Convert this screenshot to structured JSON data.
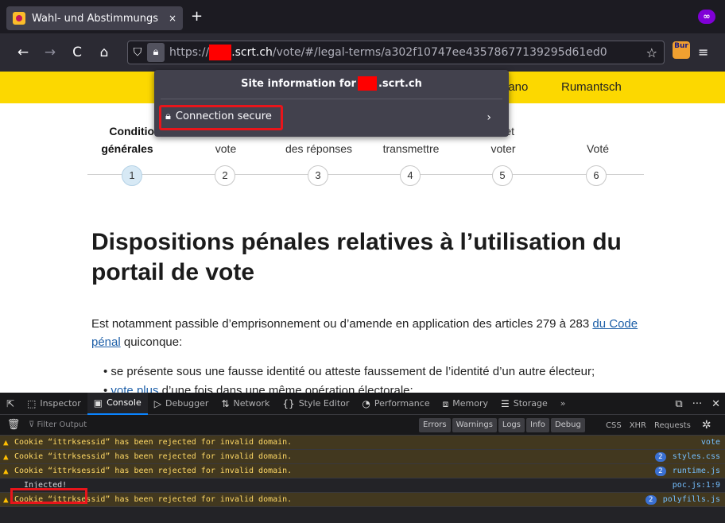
{
  "tab": {
    "title": "Wahl- und Abstimmungs",
    "close": "×"
  },
  "toolbar": {
    "new_tab": "+",
    "back": "←",
    "forward": "→",
    "reload": "C",
    "home": "⌂",
    "bookmark": "☆",
    "menu": "≡",
    "extension_label": "Bur"
  },
  "url": {
    "scheme": "https://",
    "host": ".scrt.ch",
    "path": "/vote/#/legal-terms/a302f10747ee43578677139295d61ed0"
  },
  "site_info": {
    "title_prefix": "Site information for",
    "title_host": ".scrt.ch",
    "connection_label": "Connection secure",
    "chevron": "›"
  },
  "languages": [
    "iano",
    "Rumantsch"
  ],
  "steps": [
    {
      "line1": "Condition",
      "line2": "générales",
      "number": "1",
      "active": true
    },
    {
      "line1": "",
      "line2": "vote",
      "number": "2",
      "active": false
    },
    {
      "line1": "",
      "line2": "des réponses",
      "number": "3",
      "active": false
    },
    {
      "line1": "",
      "line2": "transmettre",
      "number": "4",
      "active": false
    },
    {
      "line1": "er et",
      "line2": "voter",
      "number": "5",
      "active": false
    },
    {
      "line1": "",
      "line2": "Voté",
      "number": "6",
      "active": false
    }
  ],
  "content": {
    "heading": "Dispositions pénales relatives à l’utilisation du portail de vote",
    "para_before": "Est notamment passible d’emprisonnement ou d’amende en application des articles 279 à 283 ",
    "para_link": "du Code pénal",
    "para_after": " quiconque:",
    "bullet1": "se présente sous une fausse identité ou atteste faussement de l’identité d’un autre électeur;",
    "bullet2_link": "vote plus",
    "bullet2_rest": " d’une fois dans une même opération électorale;"
  },
  "devtools": {
    "tabs": [
      {
        "name": "inspector",
        "icon": "⬚",
        "label": "Inspector"
      },
      {
        "name": "console",
        "icon": "▣",
        "label": "Console",
        "active": true
      },
      {
        "name": "debugger",
        "icon": "▷",
        "label": "Debugger"
      },
      {
        "name": "network",
        "icon": "⇅",
        "label": "Network"
      },
      {
        "name": "style-editor",
        "icon": "{}",
        "label": "Style Editor"
      },
      {
        "name": "performance",
        "icon": "◔",
        "label": "Performance"
      },
      {
        "name": "memory",
        "icon": "⧈",
        "label": "Memory"
      },
      {
        "name": "storage",
        "icon": "☰",
        "label": "Storage"
      }
    ],
    "more": "»",
    "filter_placeholder": "Filter Output",
    "levels": [
      "Errors",
      "Warnings",
      "Logs",
      "Info",
      "Debug"
    ],
    "categories": [
      "CSS",
      "XHR",
      "Requests"
    ],
    "messages": [
      {
        "type": "warn",
        "text": "Cookie “ittrksessid” has been rejected for invalid domain.",
        "badge": "",
        "source": "vote"
      },
      {
        "type": "warn",
        "text": "Cookie “ittrksessid” has been rejected for invalid domain.",
        "badge": "2",
        "source": "styles.css"
      },
      {
        "type": "warn",
        "text": "Cookie “ittrksessid” has been rejected for invalid domain.",
        "badge": "2",
        "source": "runtime.js"
      },
      {
        "type": "log",
        "text": "Injected!",
        "badge": "",
        "source": "poc.js:1:9"
      },
      {
        "type": "warn",
        "text": "Cookie “ittrksessid” has been rejected for invalid domain.",
        "badge": "2",
        "source": "polyfills.js"
      }
    ]
  },
  "colors": {
    "yellow_bar": "#fcd800",
    "highlight_red": "#e8151b",
    "link_blue": "#1d5fa8"
  }
}
